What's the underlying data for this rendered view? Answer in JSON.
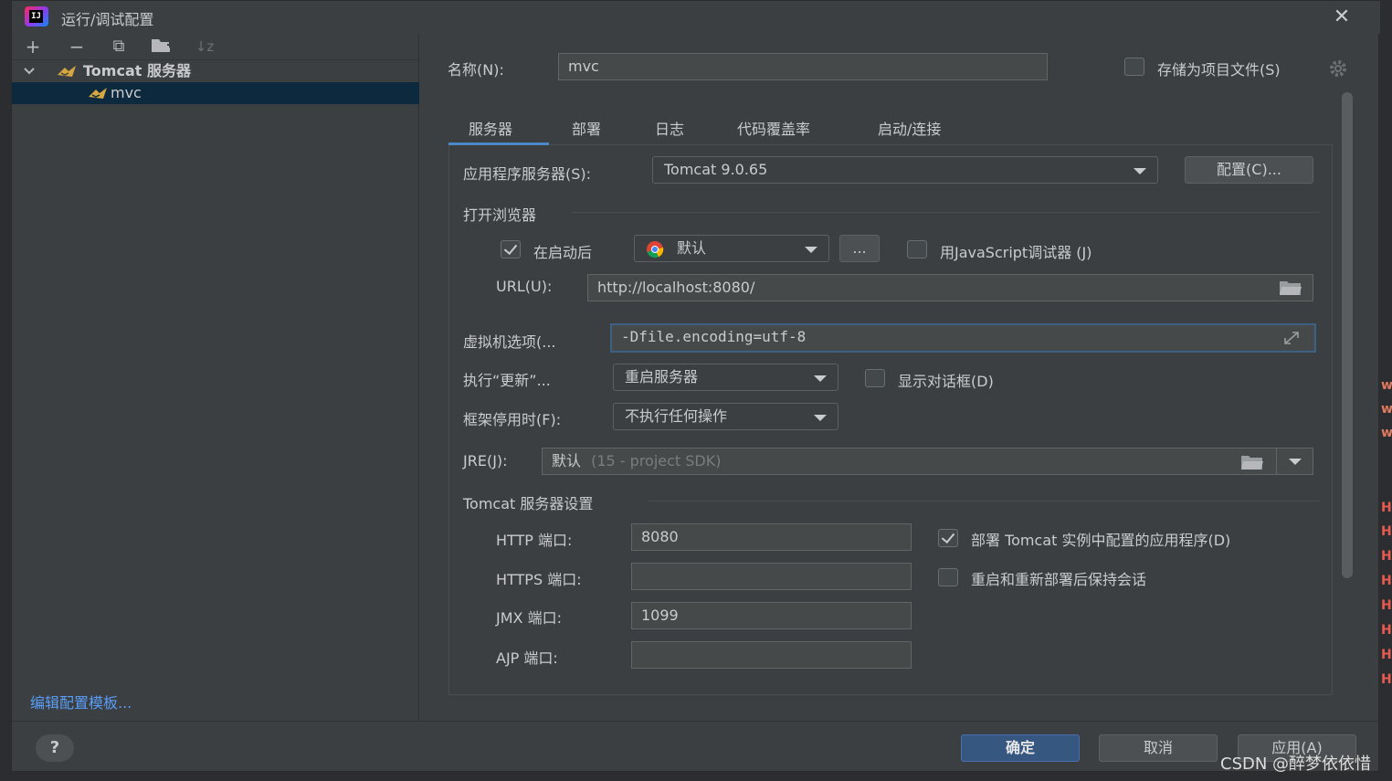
{
  "window": {
    "title": "运行/调试配置",
    "close": "✕"
  },
  "toolbar": {
    "add": "+",
    "remove": "−",
    "copy": "⧉",
    "folder": "▰",
    "sort": "↓z"
  },
  "tree": {
    "group_label": "Tomcat 服务器",
    "item_label": "mvc"
  },
  "edit_templates_link": "编辑配置模板...",
  "name": {
    "label": "名称(N):",
    "value": "mvc"
  },
  "store_as_project_file": {
    "label": "存储为项目文件(S)",
    "checked": false
  },
  "tabs": [
    "服务器",
    "部署",
    "日志",
    "代码覆盖率",
    "启动/连接"
  ],
  "active_tab": 0,
  "app_server": {
    "label": "应用程序服务器(S):",
    "value": "Tomcat 9.0.65",
    "configure_button": "配置(C)..."
  },
  "open_browser": {
    "section_label": "打开浏览器",
    "after_launch_label": "在启动后",
    "after_launch_checked": true,
    "browser_value": "默认",
    "more_button": "...",
    "js_debugger_label": "用JavaScript调试器 (J)",
    "js_debugger_checked": false,
    "url_label": "URL(U):",
    "url_value": "http://localhost:8080/"
  },
  "vm_options": {
    "label": "虚拟机选项(...",
    "value": "-Dfile.encoding=utf-8"
  },
  "on_update": {
    "label": "执行“更新”...",
    "value": "重启服务器",
    "show_dialog_label": "显示对话框(D)",
    "show_dialog_checked": false
  },
  "on_frame_deactivation": {
    "label": "框架停用时(F):",
    "value": "不执行任何操作"
  },
  "jre": {
    "label": "JRE(J):",
    "value": "默认",
    "hint": "(15 - project SDK)"
  },
  "tomcat_settings": {
    "section_label": "Tomcat 服务器设置",
    "http_port_label": "HTTP 端口:",
    "http_port_value": "8080",
    "https_port_label": "HTTPS 端口:",
    "https_port_value": "",
    "jmx_port_label": "JMX 端口:",
    "jmx_port_value": "1099",
    "ajp_port_label": "AJP 端口:",
    "ajp_port_value": "",
    "deploy_apps_label": "部署 Tomcat 实例中配置的应用程序(D)",
    "deploy_apps_checked": true,
    "preserve_sessions_label": "重启和重新部署后保持会话",
    "preserve_sessions_checked": false
  },
  "buttons": {
    "help": "?",
    "ok": "确定",
    "cancel": "取消",
    "apply": "应用(A)"
  },
  "watermark": "CSDN @醉梦依依惜",
  "edge_letters": [
    "w",
    "w",
    "w",
    "H",
    "H",
    "H",
    "H",
    "H",
    "H",
    "H",
    "H"
  ]
}
